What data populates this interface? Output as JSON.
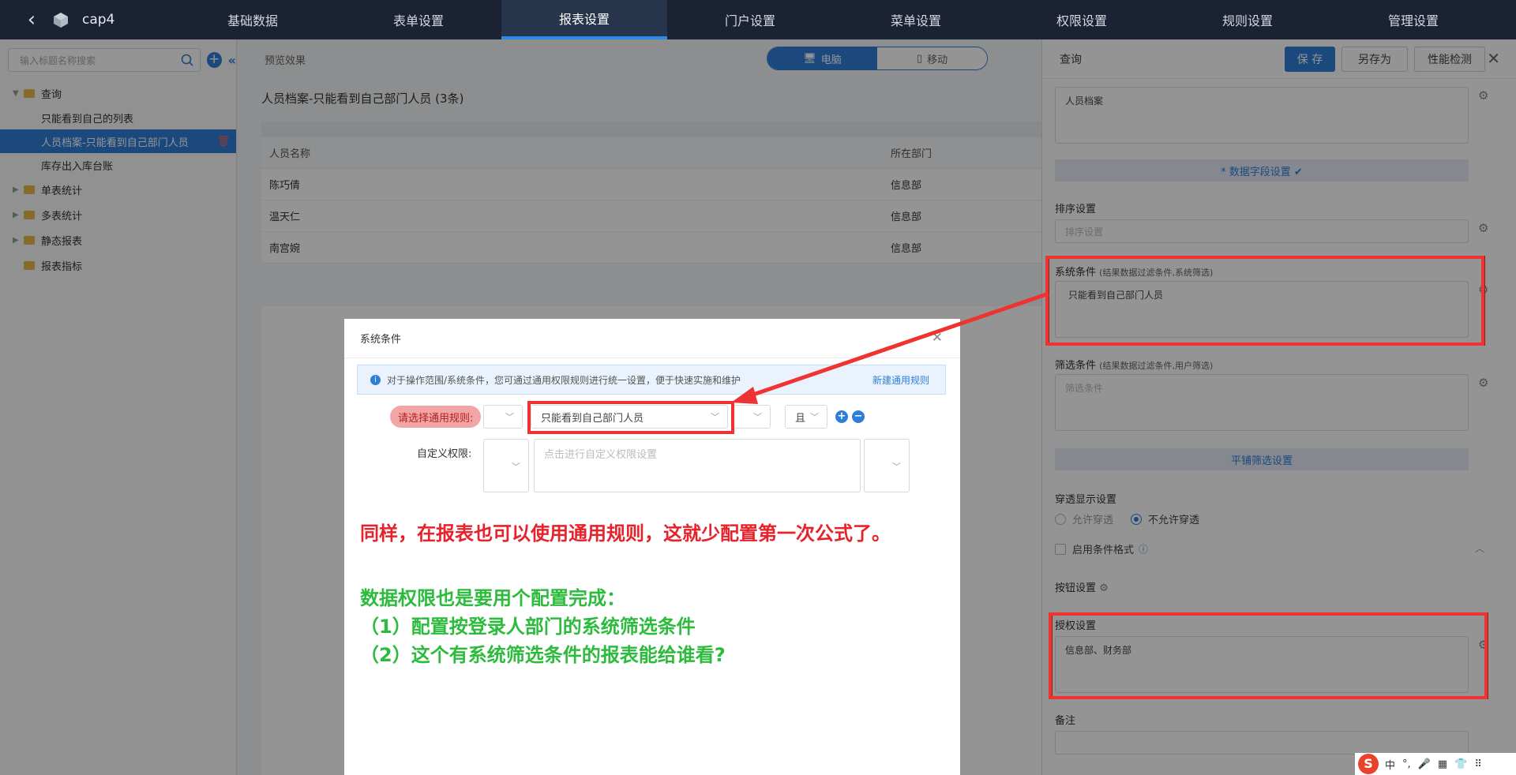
{
  "topbar": {
    "app_title": "cap4",
    "nav": [
      "基础数据",
      "表单设置",
      "报表设置",
      "门户设置",
      "菜单设置",
      "权限设置",
      "规则设置",
      "管理设置"
    ]
  },
  "sidebar": {
    "search_placeholder": "输入标题名称搜索",
    "folders": [
      {
        "label": "查询",
        "children": [
          "只能看到自己的列表",
          "人员档案-只能看到自己部门人员",
          "库存出入库台账"
        ]
      },
      {
        "label": "单表统计"
      },
      {
        "label": "多表统计"
      },
      {
        "label": "静态报表"
      },
      {
        "label": "报表指标"
      }
    ]
  },
  "main": {
    "preview_label": "预览效果",
    "toggle": [
      "电脑",
      "移动"
    ],
    "report_title": "人员档案-只能看到自己部门人员 (3条)",
    "columns": [
      "人员名称",
      "所在部门"
    ],
    "rows": [
      [
        "陈巧倩",
        "信息部"
      ],
      [
        "温天仁",
        "信息部"
      ],
      [
        "南宫婉",
        "信息部"
      ]
    ]
  },
  "rpanel": {
    "title": "查询",
    "save": "保 存",
    "save_as": "另存为",
    "perf": "性能检测",
    "name_value": "人员档案",
    "data_field_btn": "* 数据字段设置 ✔",
    "sort_label": "排序设置",
    "sort_ph": "排序设置",
    "sys_cond_label": "系统条件",
    "sys_cond_hint": "(结果数据过滤条件,系统筛选)",
    "sys_cond_value": "只能看到自己部门人员",
    "filter_label": "筛选条件",
    "filter_hint": "(结果数据过滤条件,用户筛选)",
    "filter_ph": "筛选条件",
    "flat_filter_btn": "平铺筛选设置",
    "drill_label": "穿透显示设置",
    "drill_allow": "允许穿透",
    "drill_deny": "不允许穿透",
    "cond_format": "启用条件格式",
    "button_setting": "按钮设置",
    "auth_label": "授权设置",
    "auth_value": "信息部、财务部",
    "remark_label": "备注"
  },
  "dialog": {
    "title": "系统条件",
    "info_text": "对于操作范围/系统条件，您可通过通用权限规则进行统一设置，便于快速实施和维护",
    "info_link": "新建通用规则",
    "pick_rule_label": "请选择通用规则:",
    "rule_value": "只能看到自己部门人员",
    "and_value": "且",
    "custom_label": "自定义权限:",
    "custom_ph": "点击进行自定义权限设置",
    "note_red": "同样，在报表也可以使用通用规则，这就少配置第一次公式了。",
    "note_green": [
      "数据权限也是要用个配置完成：",
      "（1）配置按登录人部门的系统筛选条件",
      "（2）这个有系统筛选条件的报表能给谁看?"
    ]
  },
  "ime": {
    "items": [
      "中",
      "°,",
      "🎤",
      "▦",
      "👕",
      "⠿"
    ]
  },
  "colors": {
    "accent": "#2f7fd8",
    "annotation_red": "#ef3333",
    "annotation_green": "#2cbb3c",
    "nav_bg": "#1b2233"
  }
}
